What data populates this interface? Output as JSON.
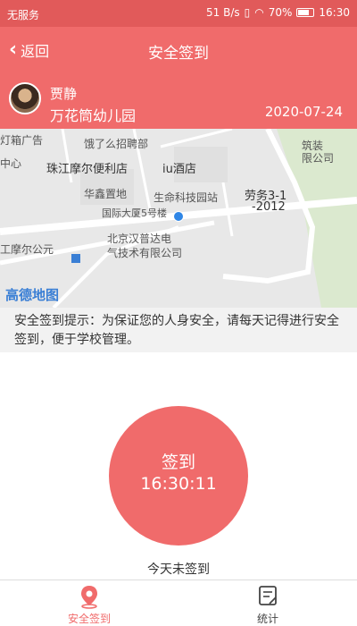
{
  "status_bar": {
    "carrier": "无服务",
    "network_speed": "51 B/s",
    "battery": "70%",
    "time": "16:30"
  },
  "nav": {
    "back_label": "返回",
    "title": "安全签到"
  },
  "profile": {
    "name": "贾静",
    "school": "万花筒幼儿园",
    "date": "2020-07-24"
  },
  "map": {
    "labels": {
      "l1": "灯箱广告",
      "l2": "饿了么招聘部",
      "l3": "中心",
      "l4": "珠江摩尔便利店",
      "l5": "iu酒店",
      "l6": "华鑫置地",
      "l7": "生命科技园站",
      "l8": "劳务3-1",
      "l9": "-2012",
      "l10": "国际大厦5号楼",
      "l11": "北京汉普达电",
      "l12": "气技术有限公司",
      "l13": "工摩尔公元",
      "l14": "筑装",
      "l15": "限公司"
    },
    "logo": "高德地图"
  },
  "tip": "安全签到提示：为保证您的人身安全，请每天记得进行安全签到，便于学校管理。",
  "sign": {
    "label": "签到",
    "time": "16:30:11",
    "status": "今天未签到"
  },
  "tabs": [
    {
      "label": "安全签到",
      "icon": "location-pin-icon",
      "active": true
    },
    {
      "label": "统计",
      "icon": "report-icon",
      "active": false
    }
  ],
  "colors": {
    "primary": "#f06b6b",
    "status_bar": "#e15a5a",
    "location": "#2f86e6"
  }
}
